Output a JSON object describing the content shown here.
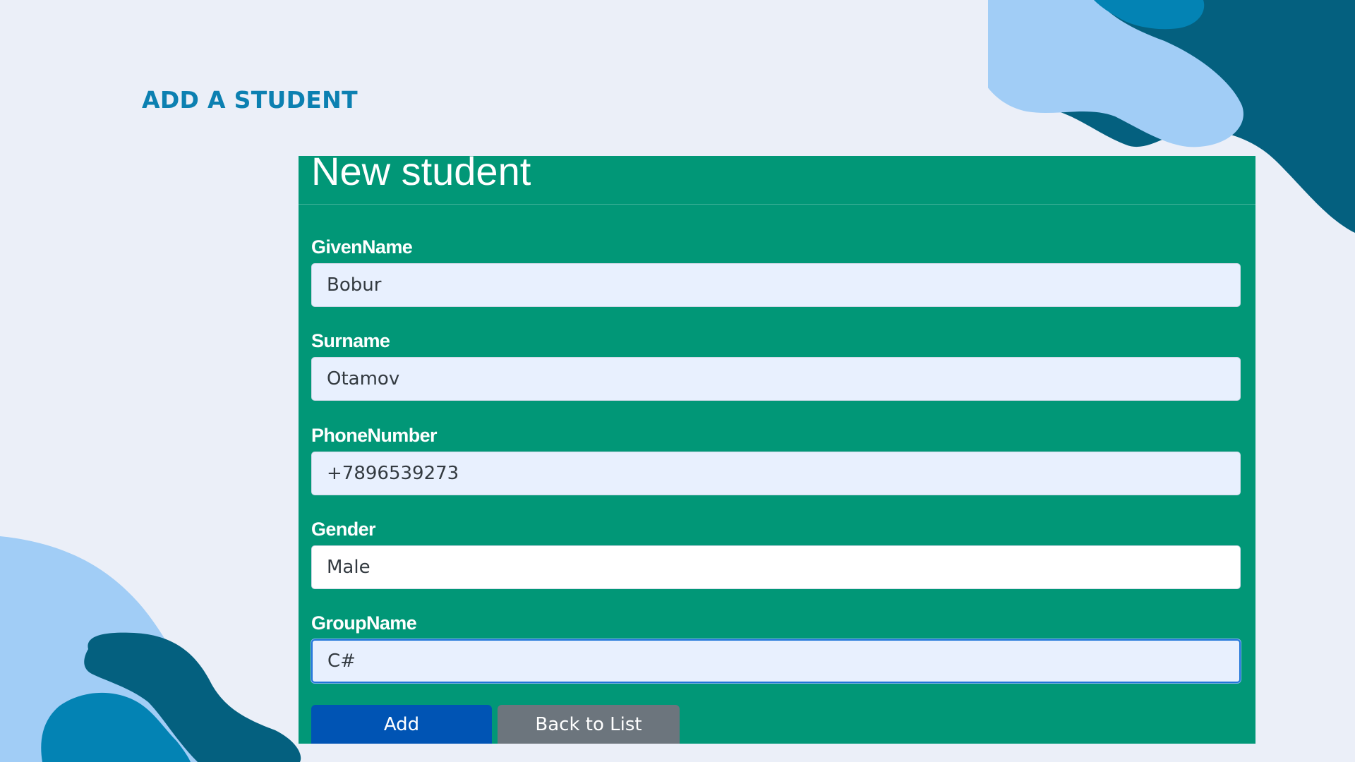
{
  "slide": {
    "heading": "ADD A STUDENT"
  },
  "form": {
    "title": "New student",
    "fields": [
      {
        "label": "GivenName",
        "value": "Bobur"
      },
      {
        "label": "Surname",
        "value": "Otamov"
      },
      {
        "label": "PhoneNumber",
        "value": "+7896539273"
      },
      {
        "label": "Gender",
        "value": "Male"
      },
      {
        "label": "GroupName",
        "value": "C#"
      }
    ],
    "buttons": {
      "add_label": "Add",
      "back_label": "Back to List"
    }
  },
  "colors": {
    "background": "#ebeff8",
    "heading": "#0c80b1",
    "panel": "#019777",
    "input_autofill": "#e8f0fe",
    "primary_button": "#0054b4",
    "secondary_button": "#6c757d",
    "blob_light": "#a1cdf6",
    "blob_dark": "#04607f",
    "blob_mid": "#0383b4"
  }
}
